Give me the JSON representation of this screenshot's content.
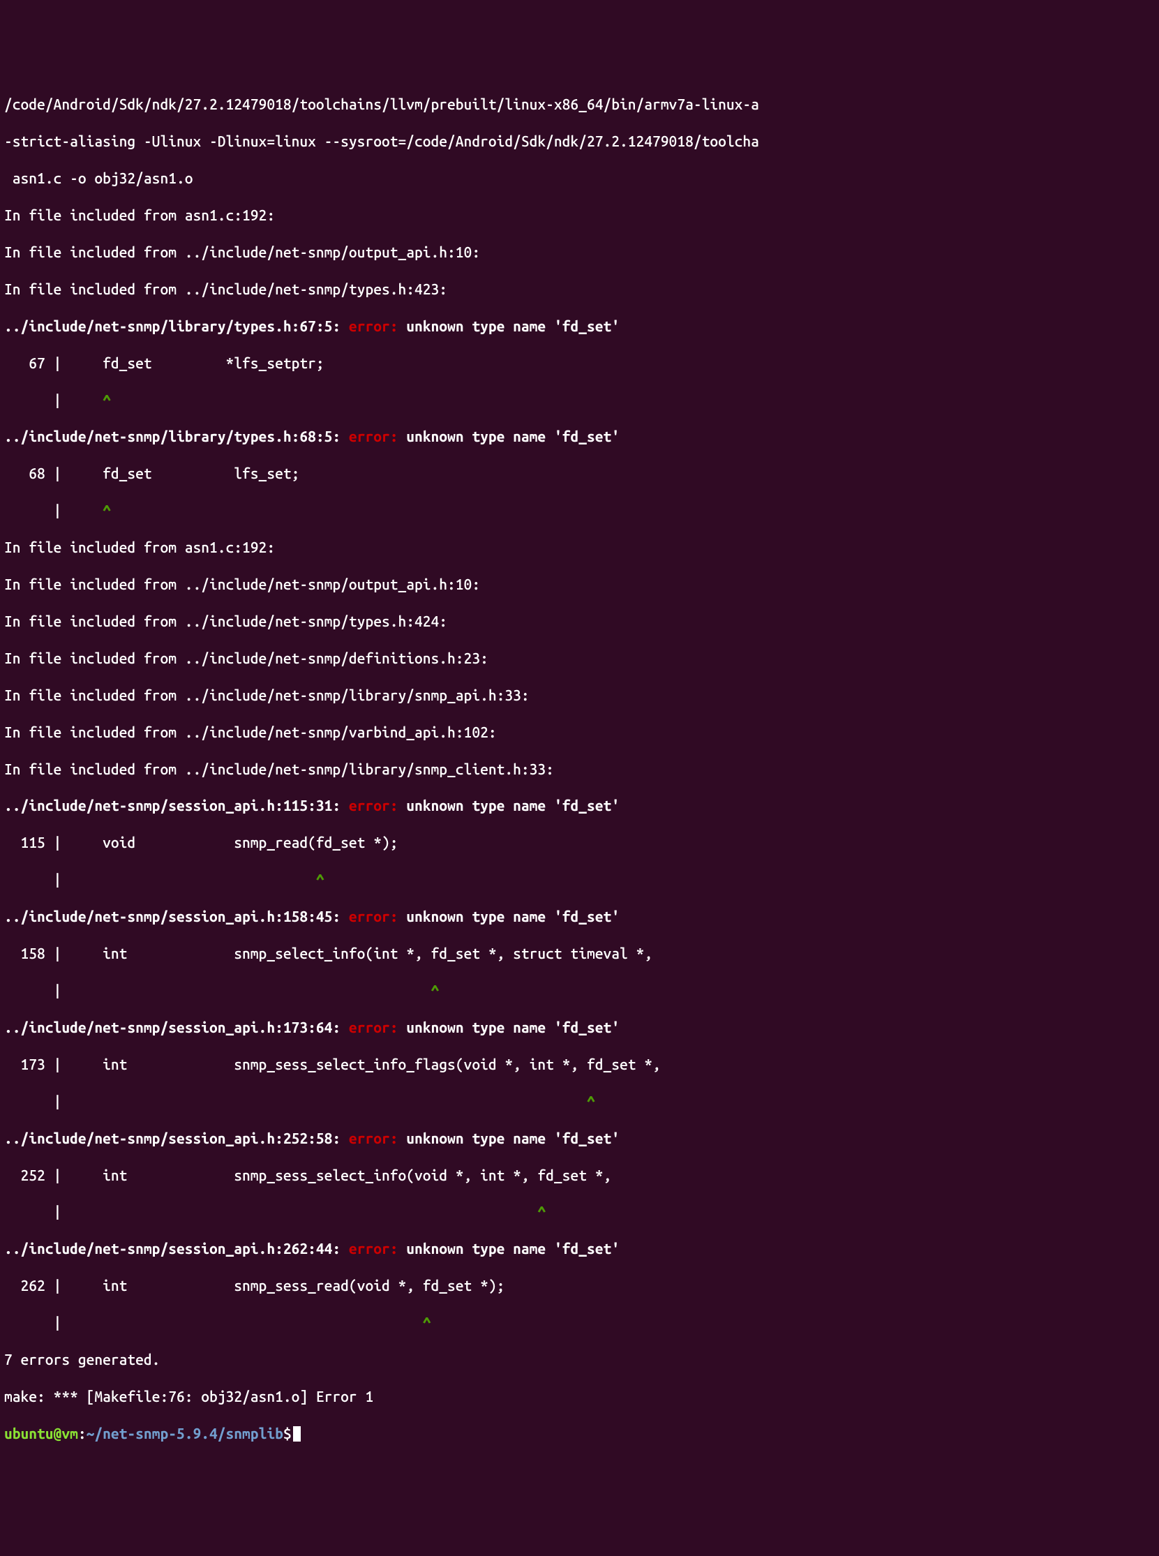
{
  "compile": {
    "l1": "/code/Android/Sdk/ndk/27.2.12479018/toolchains/llvm/prebuilt/linux-x86_64/bin/armv7a-linux-a",
    "l2": "-strict-aliasing -Ulinux -Dlinux=linux --sysroot=/code/Android/Sdk/ndk/27.2.12479018/toolcha",
    "l3": " asn1.c -o obj32/asn1.o"
  },
  "inc1": {
    "a": "In file included from asn1.c:192:",
    "b": "In file included from ../include/net-snmp/output_api.h:10:",
    "c": "In file included from ../include/net-snmp/types.h:423:"
  },
  "e1": {
    "loc": "../include/net-snmp/library/types.h:67:5:",
    "kw": " error: ",
    "msg": "unknown type name 'fd_set'",
    "code": "   67 |     fd_set         *lfs_setptr;",
    "mark1": "      |     ",
    "caret": "^"
  },
  "e2": {
    "loc": "../include/net-snmp/library/types.h:68:5:",
    "kw": " error: ",
    "msg": "unknown type name 'fd_set'",
    "code": "   68 |     fd_set          lfs_set;",
    "mark1": "      |     ",
    "caret": "^"
  },
  "inc2": {
    "a": "In file included from asn1.c:192:",
    "b": "In file included from ../include/net-snmp/output_api.h:10:",
    "c": "In file included from ../include/net-snmp/types.h:424:",
    "d": "In file included from ../include/net-snmp/definitions.h:23:",
    "e": "In file included from ../include/net-snmp/library/snmp_api.h:33:",
    "f": "In file included from ../include/net-snmp/varbind_api.h:102:",
    "g": "In file included from ../include/net-snmp/library/snmp_client.h:33:"
  },
  "e3": {
    "loc": "../include/net-snmp/session_api.h:115:31:",
    "kw": " error: ",
    "msg": "unknown type name 'fd_set'",
    "code": "  115 |     void            snmp_read(fd_set *);",
    "mark1": "      |                               ",
    "caret": "^"
  },
  "e4": {
    "loc": "../include/net-snmp/session_api.h:158:45:",
    "kw": " error: ",
    "msg": "unknown type name 'fd_set'",
    "code": "  158 |     int             snmp_select_info(int *, fd_set *, struct timeval *,",
    "mark1": "      |                                             ",
    "caret": "^"
  },
  "e5": {
    "loc": "../include/net-snmp/session_api.h:173:64:",
    "kw": " error: ",
    "msg": "unknown type name 'fd_set'",
    "code": "  173 |     int             snmp_sess_select_info_flags(void *, int *, fd_set *,",
    "mark1": "      |                                                                ",
    "caret": "^"
  },
  "e6": {
    "loc": "../include/net-snmp/session_api.h:252:58:",
    "kw": " error: ",
    "msg": "unknown type name 'fd_set'",
    "code": "  252 |     int             snmp_sess_select_info(void *, int *, fd_set *,",
    "mark1": "      |                                                          ",
    "caret": "^"
  },
  "e7": {
    "loc": "../include/net-snmp/session_api.h:262:44:",
    "kw": " error: ",
    "msg": "unknown type name 'fd_set'",
    "code": "  262 |     int             snmp_sess_read(void *, fd_set *);",
    "mark1": "      |                                            ",
    "caret": "^"
  },
  "summary": {
    "errs": "7 errors generated.",
    "make": "make: *** [Makefile:76: obj32/asn1.o] Error 1"
  },
  "prompt": {
    "user": "ubuntu@vm",
    "colon": ":",
    "path": "~/net-snmp-5.9.4/snmplib",
    "dollar": "$"
  }
}
